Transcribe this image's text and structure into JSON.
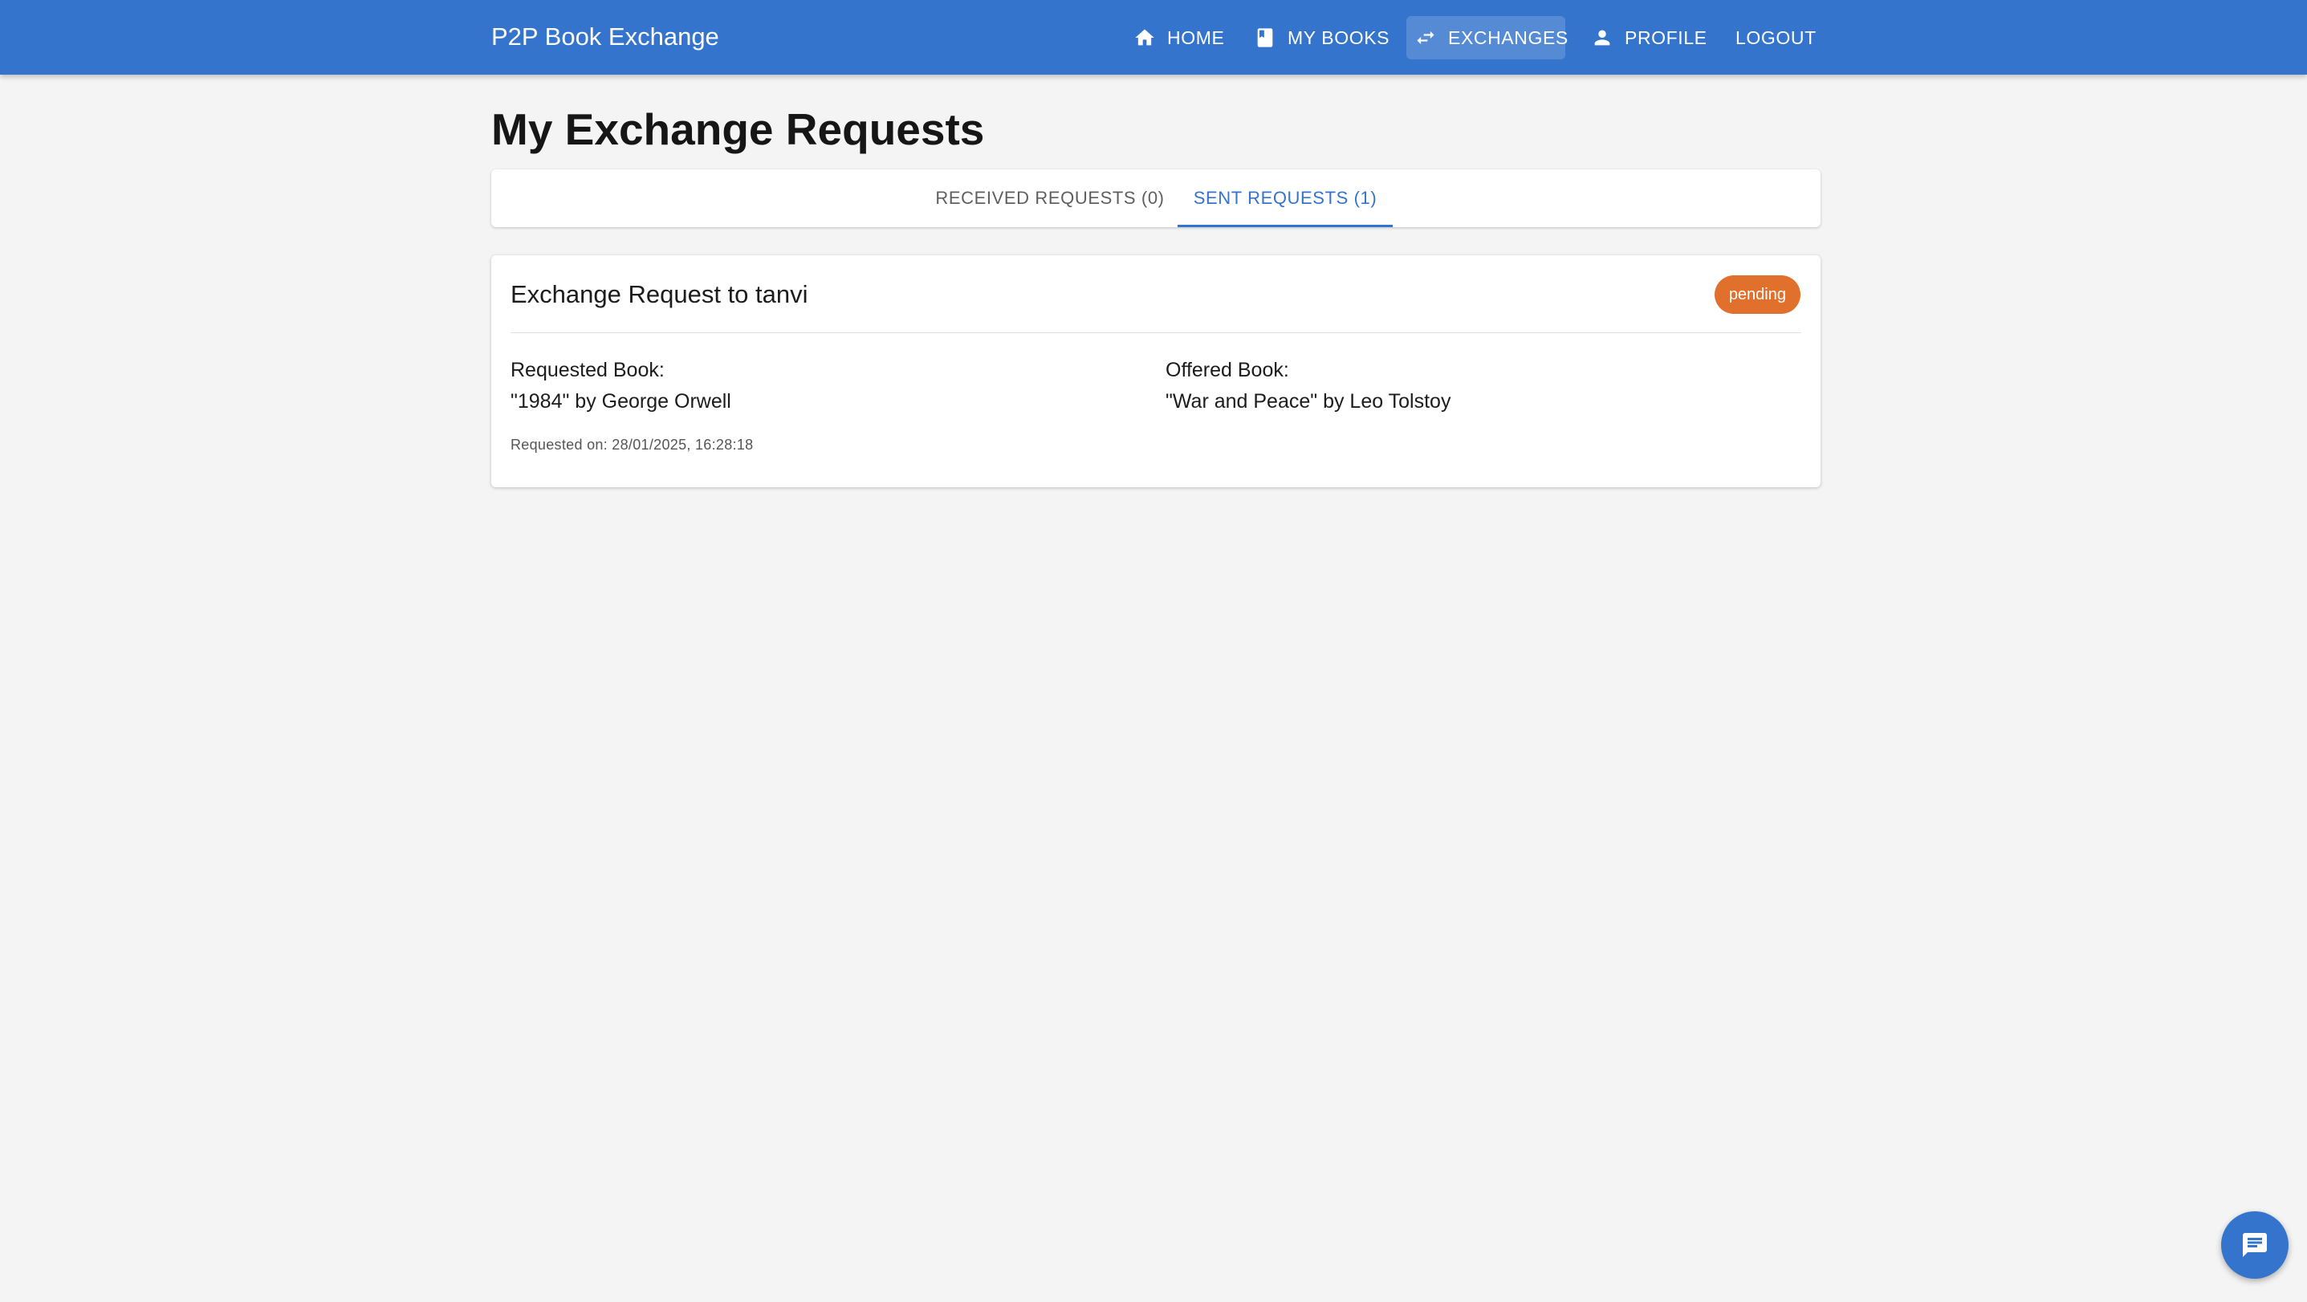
{
  "app": {
    "brand": "P2P Book Exchange",
    "accent_color": "#3574cc"
  },
  "nav": {
    "items": [
      {
        "label": "HOME",
        "icon": "home-icon"
      },
      {
        "label": "MY BOOKS",
        "icon": "book-icon"
      },
      {
        "label": "EXCHANGES",
        "icon": "swap-icon",
        "active": true
      },
      {
        "label": "PROFILE",
        "icon": "person-icon"
      },
      {
        "label": "LOGOUT"
      }
    ]
  },
  "page": {
    "title": "My Exchange Requests"
  },
  "tabs": {
    "received": "RECEIVED REQUESTS (0)",
    "sent": "SENT REQUESTS (1)",
    "selected": "sent"
  },
  "request": {
    "title": "Exchange Request to tanvi",
    "status": "pending",
    "status_color": "#e0702c",
    "requested_label": "Requested Book:",
    "requested_value": "\"1984\" by George Orwell",
    "offered_label": "Offered Book:",
    "offered_value": "\"War and Peace\" by Leo Tolstoy",
    "timestamp": "Requested on: 28/01/2025, 16:28:18"
  },
  "fab": {
    "icon": "chat-icon"
  }
}
